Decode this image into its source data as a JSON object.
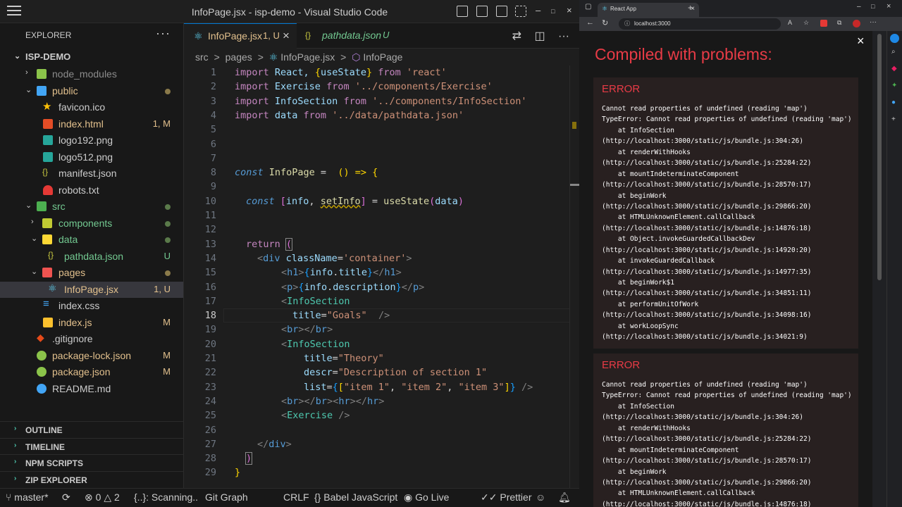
{
  "vscode": {
    "window_title": "InfoPage.jsx - isp-demo - Visual Studio Code",
    "explorer": {
      "title": "EXPLORER",
      "project": "ISP-DEMO",
      "items": [
        {
          "label": "node_modules",
          "color": "#8c8c8c",
          "status": ""
        },
        {
          "label": "public",
          "color": "#e2c08d",
          "status": "dot"
        },
        {
          "label": "favicon.ico",
          "color": "#ccc",
          "status": ""
        },
        {
          "label": "index.html",
          "color": "#e2c08d",
          "status": "1, M"
        },
        {
          "label": "logo192.png",
          "color": "#ccc",
          "status": ""
        },
        {
          "label": "logo512.png",
          "color": "#ccc",
          "status": ""
        },
        {
          "label": "manifest.json",
          "color": "#ccc",
          "status": ""
        },
        {
          "label": "robots.txt",
          "color": "#ccc",
          "status": ""
        },
        {
          "label": "src",
          "color": "#73c991",
          "status": "dot"
        },
        {
          "label": "components",
          "color": "#73c991",
          "status": "dot"
        },
        {
          "label": "data",
          "color": "#73c991",
          "status": "dot"
        },
        {
          "label": "pathdata.json",
          "color": "#73c991",
          "status": "U"
        },
        {
          "label": "pages",
          "color": "#e2c08d",
          "status": "dot"
        },
        {
          "label": "InfoPage.jsx",
          "color": "#e2c08d",
          "status": "1, U"
        },
        {
          "label": "index.css",
          "color": "#ccc",
          "status": ""
        },
        {
          "label": "index.js",
          "color": "#e2c08d",
          "status": "M"
        },
        {
          "label": ".gitignore",
          "color": "#ccc",
          "status": ""
        },
        {
          "label": "package-lock.json",
          "color": "#e2c08d",
          "status": "M"
        },
        {
          "label": "package.json",
          "color": "#e2c08d",
          "status": "M"
        },
        {
          "label": "README.md",
          "color": "#ccc",
          "status": ""
        }
      ],
      "sections": [
        "OUTLINE",
        "TIMELINE",
        "NPM SCRIPTS",
        "ZIP EXPLORER"
      ]
    },
    "tabs": [
      {
        "label": "InfoPage.jsx",
        "status": "1, U",
        "close": "×"
      },
      {
        "label": "pathdata.json",
        "status": "U"
      }
    ],
    "breadcrumb": [
      "src",
      ">",
      "pages",
      ">",
      "InfoPage.jsx",
      ">",
      "InfoPage"
    ],
    "line_numbers": [
      "1",
      "2",
      "3",
      "4",
      "5",
      "6",
      "7",
      "8",
      "9",
      "10",
      "11",
      "12",
      "13",
      "14",
      "15",
      "16",
      "17",
      "18",
      "19",
      "20",
      "21",
      "22",
      "23",
      "24",
      "25",
      "26",
      "27",
      "28",
      "29"
    ],
    "code": {
      "l1": [
        "import",
        " React, ",
        "{",
        "useState",
        "}",
        " from",
        " 'react'"
      ],
      "l2": [
        "import",
        " Exercise",
        " from",
        " '../components/Exercise'"
      ],
      "l3": [
        "import",
        " InfoSection",
        " from",
        " '../components/InfoSection'"
      ],
      "l4": [
        "import",
        " data",
        " from",
        " '../data/pathdata.json'"
      ],
      "l8": [
        "const",
        " InfoPage",
        " = ",
        " () => ",
        "{"
      ],
      "l10": [
        "const",
        " [",
        "info",
        ", ",
        "setInfo",
        "]",
        " = ",
        "useState",
        "(",
        "data",
        ")"
      ],
      "l13": [
        "return",
        " ",
        "("
      ],
      "l14": [
        "<",
        "div",
        " className",
        "=",
        "'container'",
        ">"
      ],
      "l15": [
        "<",
        "h1",
        ">",
        "{",
        "info",
        ".",
        "title",
        "}",
        "</",
        "h1",
        ">"
      ],
      "l16": [
        "<",
        "p",
        ">",
        "{",
        "info",
        ".",
        "description",
        "}",
        "</",
        "p",
        ">"
      ],
      "l17": [
        "<",
        "InfoSection"
      ],
      "l18": [
        "title",
        "=",
        "\"Goals\"",
        "  />"
      ],
      "l19": [
        "<",
        "br",
        "></",
        "br",
        ">"
      ],
      "l20": [
        "<",
        "InfoSection"
      ],
      "l21": [
        "title",
        "=",
        "\"Theory\""
      ],
      "l22": [
        "descr",
        "=",
        "\"Description of section 1\""
      ],
      "l23": [
        "list",
        "=",
        "{",
        "[",
        "\"item 1\"",
        ", ",
        "\"item 2\"",
        ", ",
        "\"item 3\"",
        "]",
        "}",
        " />"
      ],
      "l24": [
        "<",
        "br",
        "></",
        "br",
        "><",
        "hr",
        "></",
        "hr",
        ">"
      ],
      "l25": [
        "<",
        "Exercise",
        " />"
      ],
      "l27": [
        "</",
        "div",
        ">"
      ],
      "l28": [
        ")"
      ],
      "l29": [
        "}"
      ]
    },
    "status": {
      "branch": "master*",
      "errors": "0",
      "warnings": "2",
      "scanning": "{..}: Scanning..",
      "git_graph": "Git Graph",
      "eol": "CRLF",
      "language": "Babel JavaScript",
      "golive": "Go Live",
      "prettier": "Prettier"
    }
  },
  "browser": {
    "tab_title": "React App",
    "url": "localhost:3000",
    "overlay_title": "Compiled with problems:",
    "errors": [
      {
        "title": "ERROR",
        "lines": [
          "Cannot read properties of undefined (reading 'map')",
          "TypeError: Cannot read properties of undefined (reading 'map')",
          "    at InfoSection",
          "(http://localhost:3000/static/js/bundle.js:304:26)",
          "    at renderWithHooks",
          "(http://localhost:3000/static/js/bundle.js:25284:22)",
          "    at mountIndeterminateComponent",
          "(http://localhost:3000/static/js/bundle.js:28570:17)",
          "    at beginWork",
          "(http://localhost:3000/static/js/bundle.js:29866:20)",
          "    at HTMLUnknownElement.callCallback",
          "(http://localhost:3000/static/js/bundle.js:14876:18)",
          "    at Object.invokeGuardedCallbackDev",
          "(http://localhost:3000/static/js/bundle.js:14920:20)",
          "    at invokeGuardedCallback",
          "(http://localhost:3000/static/js/bundle.js:14977:35)",
          "    at beginWork$1",
          "(http://localhost:3000/static/js/bundle.js:34851:11)",
          "    at performUnitOfWork",
          "(http://localhost:3000/static/js/bundle.js:34098:16)",
          "    at workLoopSync",
          "(http://localhost:3000/static/js/bundle.js:34021:9)"
        ]
      },
      {
        "title": "ERROR",
        "lines": [
          "Cannot read properties of undefined (reading 'map')",
          "TypeError: Cannot read properties of undefined (reading 'map')",
          "    at InfoSection",
          "(http://localhost:3000/static/js/bundle.js:304:26)",
          "    at renderWithHooks",
          "(http://localhost:3000/static/js/bundle.js:25284:22)",
          "    at mountIndeterminateComponent",
          "(http://localhost:3000/static/js/bundle.js:28570:17)",
          "    at beginWork",
          "(http://localhost:3000/static/js/bundle.js:29866:20)",
          "    at HTMLUnknownElement.callCallback",
          "(http://localhost:3000/static/js/bundle.js:14876:18)"
        ]
      }
    ],
    "close": "×"
  }
}
